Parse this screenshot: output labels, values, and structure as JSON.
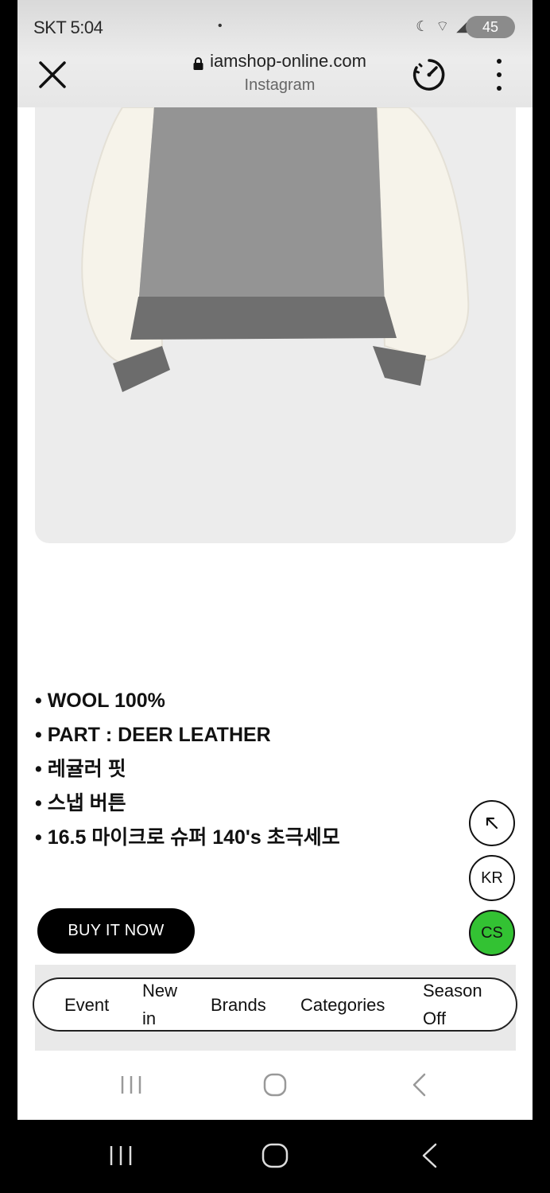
{
  "status_bar": {
    "time": "SKT 5:04",
    "indicator_dot": "•",
    "system_icons": "☾ ⌔ ◢",
    "battery": "45"
  },
  "browser": {
    "url": "iamshop-online.com",
    "source": "Instagram",
    "icons": [
      "close-icon",
      "lock-icon",
      "speedometer-icon",
      "more-vertical-icon"
    ]
  },
  "product": {
    "details": [
      "WOOL 100%",
      "PART : DEER LEATHER",
      "레귤러 핏",
      "스냅 버튼",
      "16.5 마이크로 슈퍼 140's 초극세모"
    ],
    "buy_label": "BUY IT NOW"
  },
  "floating_buttons": {
    "scroll_top_icon": "arrow-up-left-icon",
    "kr_label": "KR",
    "cs_label": "CS"
  },
  "category_nav": {
    "event": "Event",
    "new_line1": "New",
    "new_line2": "in",
    "brands": "Brands",
    "categories": "Categories",
    "season_line1": "Season",
    "season_line2": "Off"
  },
  "colors": {
    "accent_cs": "#33c233",
    "buy_button": "#000000",
    "image_bg": "#ececec"
  }
}
